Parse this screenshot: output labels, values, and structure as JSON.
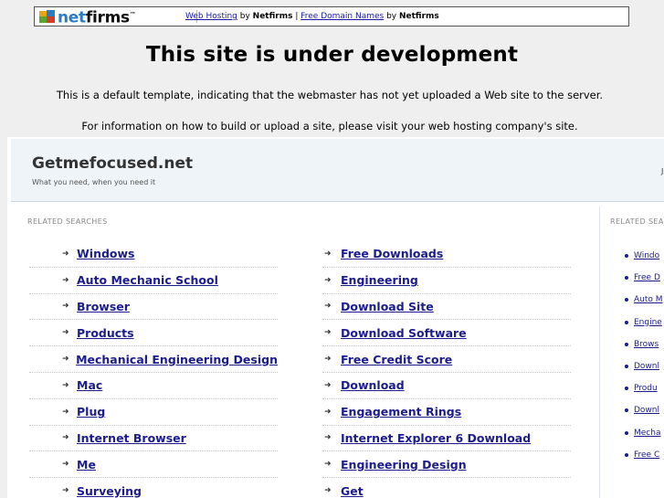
{
  "topbar": {
    "logo_text_net": "net",
    "logo_text_firms": "firms",
    "logo_tm": "™",
    "link_hosting": "Web Hosting",
    "by_1": " by ",
    "brand_1": "Netfirms",
    "divider": " | ",
    "link_domains": "Free Domain Names",
    "by_2": " by ",
    "brand_2": "Netfirms"
  },
  "headline": "This site is under development",
  "info_line_1": "This is a default template, indicating that the webmaster has not yet uploaded a Web site to the server.",
  "info_line_2": "For information on how to build or upload a site, please visit your web hosting company's site.",
  "site": {
    "brand": "Getmefocused.net",
    "tagline": "What you need, when you need it",
    "header_right": "J",
    "related_label": "RELATED SEARCHES",
    "related_label_side": "RELATED SEA",
    "arrow": "➜",
    "left_links": [
      "Windows",
      "Auto Mechanic School",
      "Browser",
      "Products",
      "Mechanical Engineering Design",
      "Mac",
      "Plug",
      "Internet Browser",
      "Me",
      "Surveying"
    ],
    "right_links": [
      "Free Downloads",
      "Engineering",
      "Download Site",
      "Download Software",
      "Free Credit Score",
      "Download",
      "Engagement Rings",
      "Internet Explorer 6 Download",
      "Engineering Design",
      "Get"
    ],
    "side_links": [
      "Windo",
      "Free D",
      "Auto M",
      "Engine",
      "Brows",
      "Downl",
      "Produ",
      "Downl",
      "Mecha",
      "Free C"
    ]
  },
  "colors": {
    "page_bg": "#efefef",
    "link": "#1c1c8c",
    "header_bg": "#eef4f8"
  }
}
